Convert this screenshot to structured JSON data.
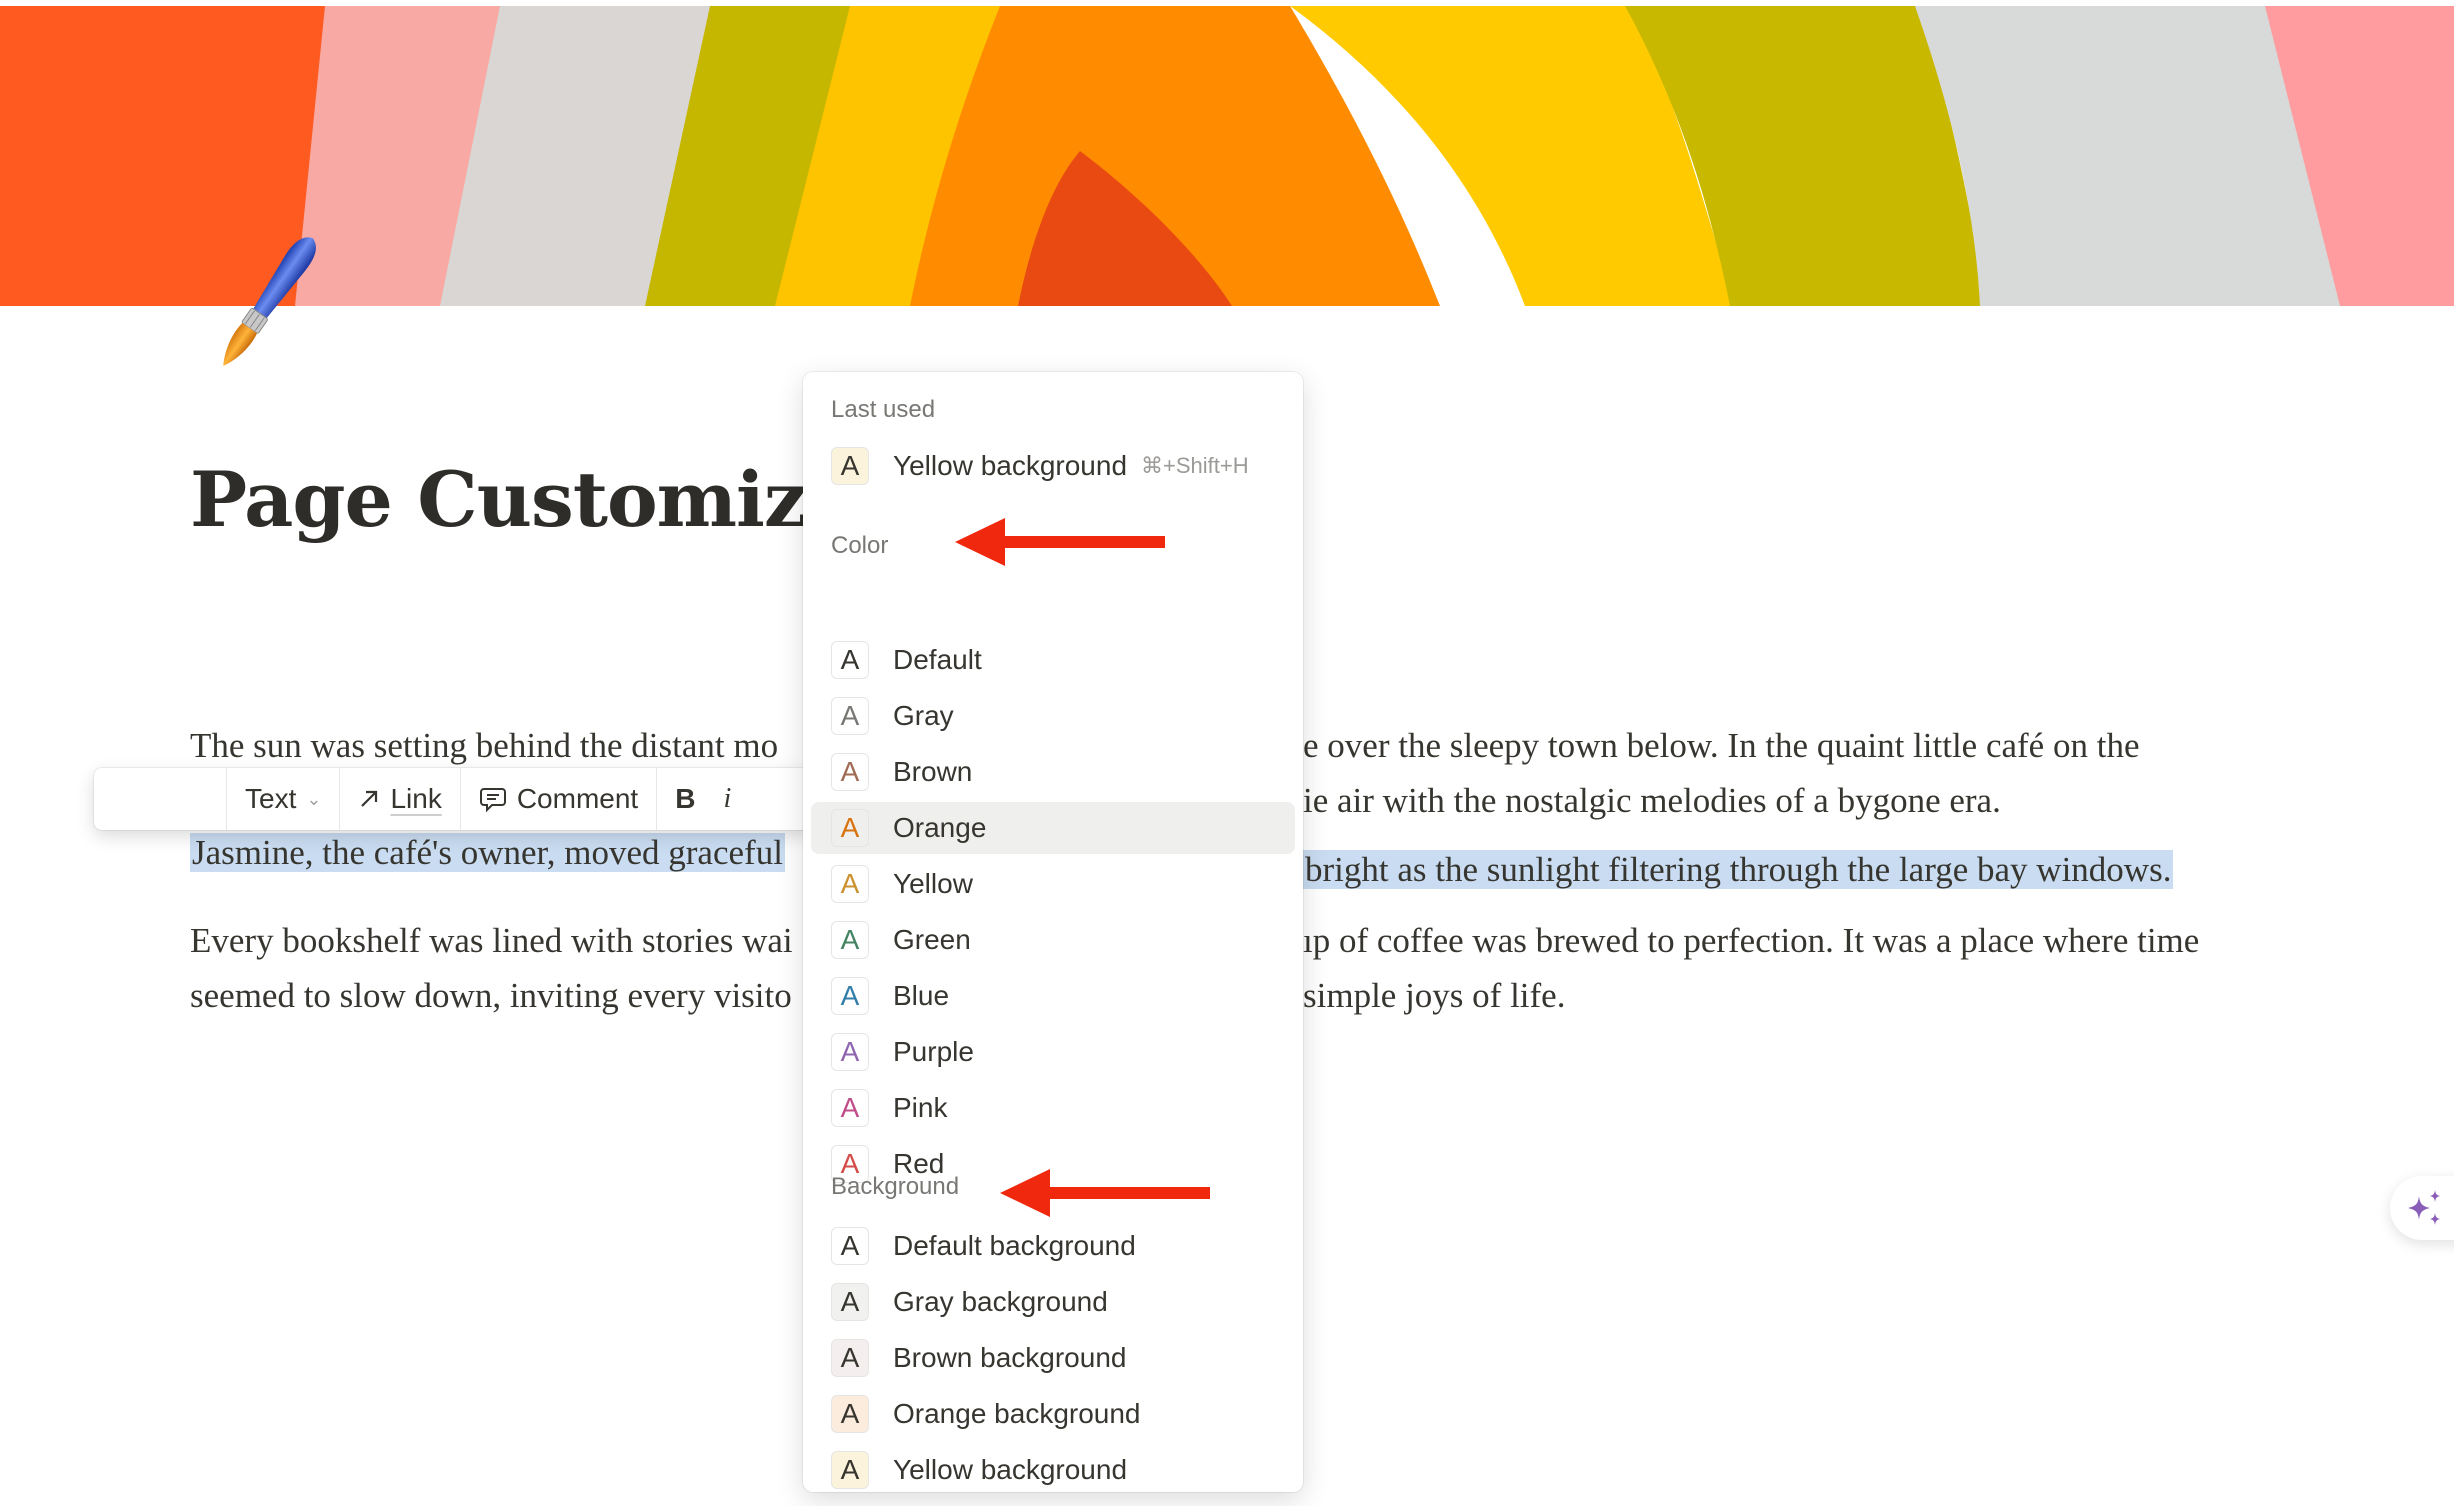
{
  "page": {
    "title": "Page Customizat",
    "icon": "paintbrush-icon"
  },
  "cover": {
    "stripes": [
      "#ff5a1f",
      "#f9a9a3",
      "#d9d6d3",
      "#c5b700",
      "#ffc400",
      "#ff8c00",
      "#e84a12",
      "#ff8c00",
      "#ffcb00",
      "#c8b800",
      "#d8d9d9",
      "#ff9ca0"
    ]
  },
  "body": {
    "paragraphs": [
      {
        "left": "The sun was setting behind the distant mo",
        "right": "e over the sleepy town below. In the quaint little café on the"
      },
      {
        "left": "",
        "right": "ie air with the nostalgic melodies of a bygone era."
      },
      {
        "left": "Jasmine, the café's owner, moved graceful",
        "right": " bright as the sunlight filtering through the large bay windows."
      },
      {
        "left": "Every bookshelf was lined with stories wai",
        "right": "ıp of coffee was brewed to perfection. It was a place where time"
      },
      {
        "left": "seemed to slow down, inviting every visito",
        "right": "simple joys of life."
      }
    ],
    "selection_color": "#c9dcf1"
  },
  "toolbar": {
    "text_label": "Text",
    "link_label": "Link",
    "comment_label": "Comment",
    "bold_label": "B",
    "italic_label": "i"
  },
  "menu": {
    "last_used_header": "Last used",
    "last_used": {
      "label": "Yellow background",
      "shortcut": "⌘+Shift+H",
      "swatch_bg": "#fbf3db",
      "glyph_color": "#37352f"
    },
    "color_header": "Color",
    "colors": [
      {
        "label": "Default",
        "glyph": "A",
        "glyph_color": "#37352f"
      },
      {
        "label": "Gray",
        "glyph": "A",
        "glyph_color": "#787774"
      },
      {
        "label": "Brown",
        "glyph": "A",
        "glyph_color": "#9f6b53"
      },
      {
        "label": "Orange",
        "glyph": "A",
        "glyph_color": "#d9730d",
        "hovered": true
      },
      {
        "label": "Yellow",
        "glyph": "A",
        "glyph_color": "#cb912f"
      },
      {
        "label": "Green",
        "glyph": "A",
        "glyph_color": "#448361"
      },
      {
        "label": "Blue",
        "glyph": "A",
        "glyph_color": "#337ea9"
      },
      {
        "label": "Purple",
        "glyph": "A",
        "glyph_color": "#9065b0"
      },
      {
        "label": "Pink",
        "glyph": "A",
        "glyph_color": "#c14c8a"
      },
      {
        "label": "Red",
        "glyph": "A",
        "glyph_color": "#d44c47"
      }
    ],
    "background_header": "Background",
    "backgrounds": [
      {
        "label": "Default background",
        "glyph": "A",
        "swatch_bg": "#ffffff"
      },
      {
        "label": "Gray background",
        "glyph": "A",
        "swatch_bg": "#f1f1ef"
      },
      {
        "label": "Brown background",
        "glyph": "A",
        "swatch_bg": "#f4eeee"
      },
      {
        "label": "Orange background",
        "glyph": "A",
        "swatch_bg": "#fbecdd"
      },
      {
        "label": "Yellow background",
        "glyph": "A",
        "swatch_bg": "#fbf3db"
      }
    ]
  },
  "annotations": {
    "arrow_color": "#f0290e"
  },
  "ai_button": {
    "icon": "sparkle-icon",
    "color": "#8a5db8"
  }
}
